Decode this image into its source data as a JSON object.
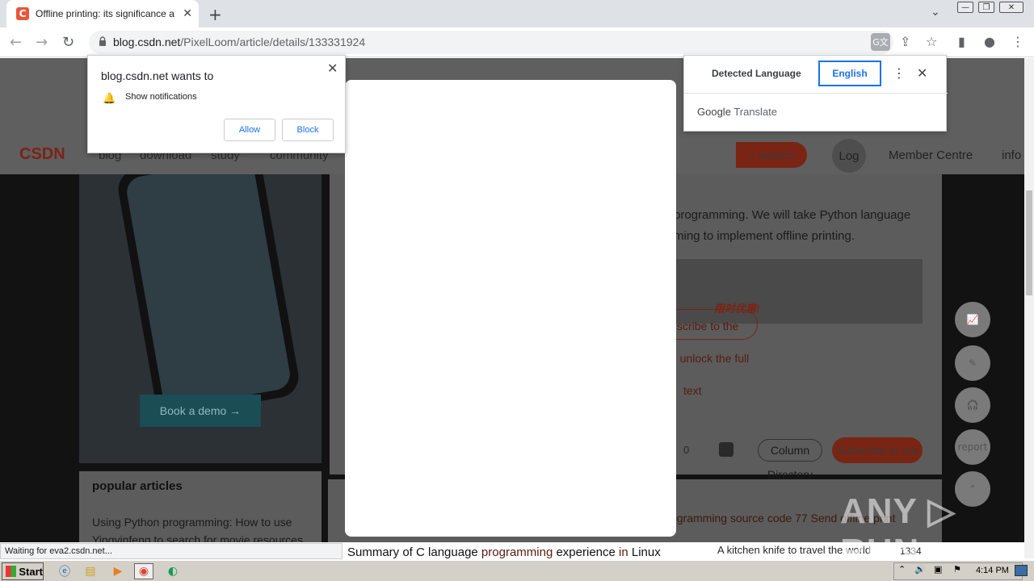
{
  "tab": {
    "title": "Offline printing: its significance and i",
    "close": "✕",
    "favicon": "C"
  },
  "new_tab": "+",
  "window": {
    "minimize": "—",
    "restore": "❐",
    "close": "✕",
    "tab_search": "⌄"
  },
  "toolbar": {
    "back": "←",
    "forward": "→",
    "reload": "↻",
    "url_host": "blog.csdn.net",
    "url_path": "/PixelLoom/article/details/133331924"
  },
  "icons": {
    "translate": "G文",
    "share": "⇪",
    "star": "☆",
    "sidebar": "▮",
    "profile": "●",
    "menu": "⋮"
  },
  "notification": {
    "title": "blog.csdn.net wants to",
    "description": "Show notifications",
    "allow": "Allow",
    "block": "Block",
    "close": "✕",
    "bell": "🔔"
  },
  "translate_popup": {
    "detected": "Detected Language",
    "english": "English",
    "menu": "⋮",
    "close": "✕",
    "brand_google": "Google",
    "brand_translate": "Translate"
  },
  "site": {
    "logo": "CSDN",
    "nav": [
      "blog",
      "download",
      "study",
      "community"
    ],
    "search": "search",
    "login": "Log",
    "login2": "in",
    "member_centre": "Member Centre",
    "info": "info",
    "ad_button": "Book a demo →",
    "popular_title": "popular articles",
    "popular_item": "Using Python programming: How to use Yingyinfeng to search for movie resources",
    "article_line1": "programming. We will take Python language",
    "article_line2": "ming to implement offline printing.",
    "promo_badge": "限时优惠!",
    "subscribe_to": "scribe to the",
    "unlock": "o unlock the full",
    "text_word": "text",
    "comment_count": "0",
    "column": "Column",
    "directory": "Directory",
    "subscribe_our": "Subscribe to our",
    "side_report": "report",
    "list_line": "ogramming source code 77 Send offline print",
    "summary_prefix": "Summary of C language ",
    "summary_prog": "programming",
    "summary_mid": " experience ",
    "summary_in": "in",
    "summary_end": " Linux",
    "kitchen": "A kitchen knife to travel the world",
    "views": "1334"
  },
  "status": "Waiting for eva2.csdn.net...",
  "watermark": "ANY ▷ RUN",
  "taskbar": {
    "start": "Start",
    "clock": "4:14 PM"
  },
  "colors": {
    "accent_red": "#fc5531",
    "link_blue": "#1a73e8"
  }
}
